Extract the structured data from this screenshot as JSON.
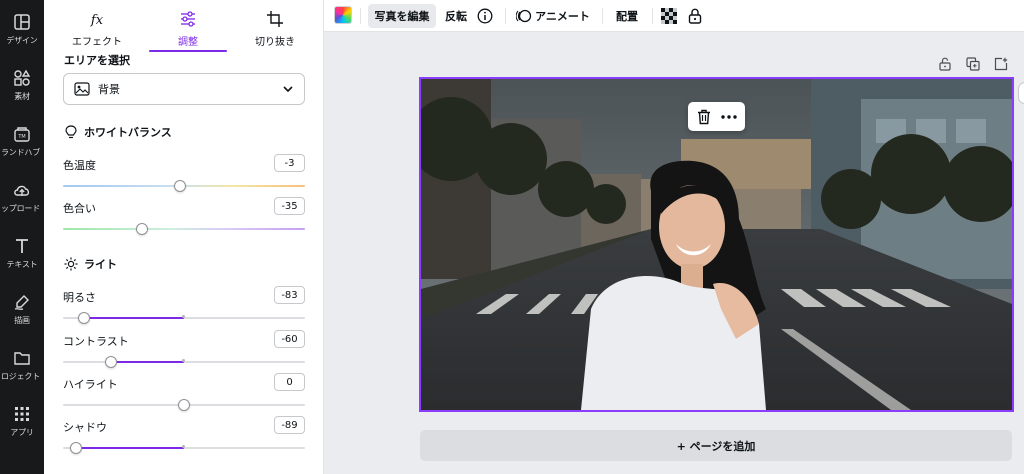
{
  "rail": {
    "items": [
      {
        "label": "デザイン",
        "icon": "layout-icon"
      },
      {
        "label": "素材",
        "icon": "elements-icon"
      },
      {
        "label": "ランドハブ",
        "icon": "brand-hub-icon"
      },
      {
        "label": "ップロード",
        "icon": "upload-icon"
      },
      {
        "label": "テキスト",
        "icon": "text-icon"
      },
      {
        "label": "描画",
        "icon": "draw-icon"
      },
      {
        "label": "ロジェクト",
        "icon": "folder-icon"
      },
      {
        "label": "アプリ",
        "icon": "apps-icon"
      }
    ]
  },
  "panel": {
    "tabs": [
      {
        "label": "エフェクト",
        "icon": "fx-icon",
        "active": false
      },
      {
        "label": "調整",
        "icon": "sliders-icon",
        "active": true
      },
      {
        "label": "切り抜き",
        "icon": "crop-icon",
        "active": false
      }
    ],
    "area_title": "エリアを選択",
    "area_select_value": "背景",
    "white_balance": {
      "title": "ホワイトバランス",
      "sliders": [
        {
          "label": "色温度",
          "value": "-3",
          "level": -3
        },
        {
          "label": "色合い",
          "value": "-35",
          "level": -35
        }
      ]
    },
    "light": {
      "title": "ライト",
      "sliders": [
        {
          "label": "明るさ",
          "value": "-83",
          "level": -83
        },
        {
          "label": "コントラスト",
          "value": "-60",
          "level": -60
        },
        {
          "label": "ハイライト",
          "value": "0",
          "level": 0
        },
        {
          "label": "シャドウ",
          "value": "-89",
          "level": -89
        }
      ]
    }
  },
  "toolbar": {
    "edit_photo": "写真を編集",
    "flip": "反転",
    "animate": "アニメート",
    "position": "配置"
  },
  "canvas": {
    "add_page": "+ ページを追加"
  },
  "colors": {
    "accent": "#7d2ae8",
    "selection": "#8b3dff",
    "rail_bg": "#18191b"
  }
}
